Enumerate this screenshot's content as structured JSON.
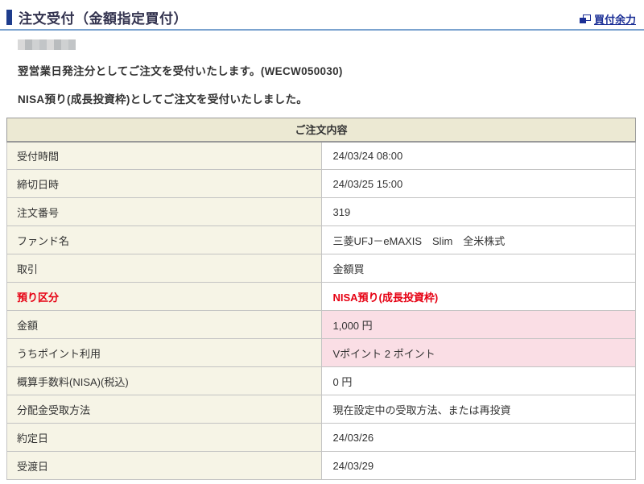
{
  "header": {
    "title": "注文受付（金額指定買付）",
    "buying_power_link": "買付余力",
    "icon": "popup-window-icon"
  },
  "notices": [
    "翌営業日発注分としてご注文を受付いたします。(WECW050030)",
    "NISA預り(成長投資枠)としてご注文を受付いたしました。"
  ],
  "table": {
    "caption": "ご注文内容",
    "rows": [
      {
        "label": "受付時間",
        "value": "24/03/24 08:00",
        "style": "normal"
      },
      {
        "label": "締切日時",
        "value": "24/03/25 15:00",
        "style": "normal"
      },
      {
        "label": "注文番号",
        "value": "319",
        "style": "normal"
      },
      {
        "label": "ファンド名",
        "value": "三菱UFJ－eMAXIS　Slim　全米株式",
        "style": "normal"
      },
      {
        "label": "取引",
        "value": "金額買",
        "style": "normal"
      },
      {
        "label": "預り区分",
        "value": "NISA預り(成長投資枠)",
        "style": "red"
      },
      {
        "label": "金額",
        "value": "1,000 円",
        "style": "pink"
      },
      {
        "label": "うちポイント利用",
        "value": "Vポイント 2 ポイント",
        "style": "pink"
      },
      {
        "label": "概算手数料(NISA)(税込)",
        "value": "0 円",
        "style": "normal"
      },
      {
        "label": "分配金受取方法",
        "value": "現在設定中の受取方法、または再投資",
        "style": "normal"
      },
      {
        "label": "約定日",
        "value": "24/03/26",
        "style": "normal"
      },
      {
        "label": "受渡日",
        "value": "24/03/29",
        "style": "normal"
      }
    ]
  },
  "colors": {
    "accent_navy": "#1e3c8c",
    "link_navy": "#1b2f96",
    "rule_blue": "#7ba3cf",
    "caption_bg": "#ece9d3",
    "label_bg": "#f6f4e6",
    "highlight_pink_bg": "#fadee5",
    "alert_red": "#e60012"
  }
}
